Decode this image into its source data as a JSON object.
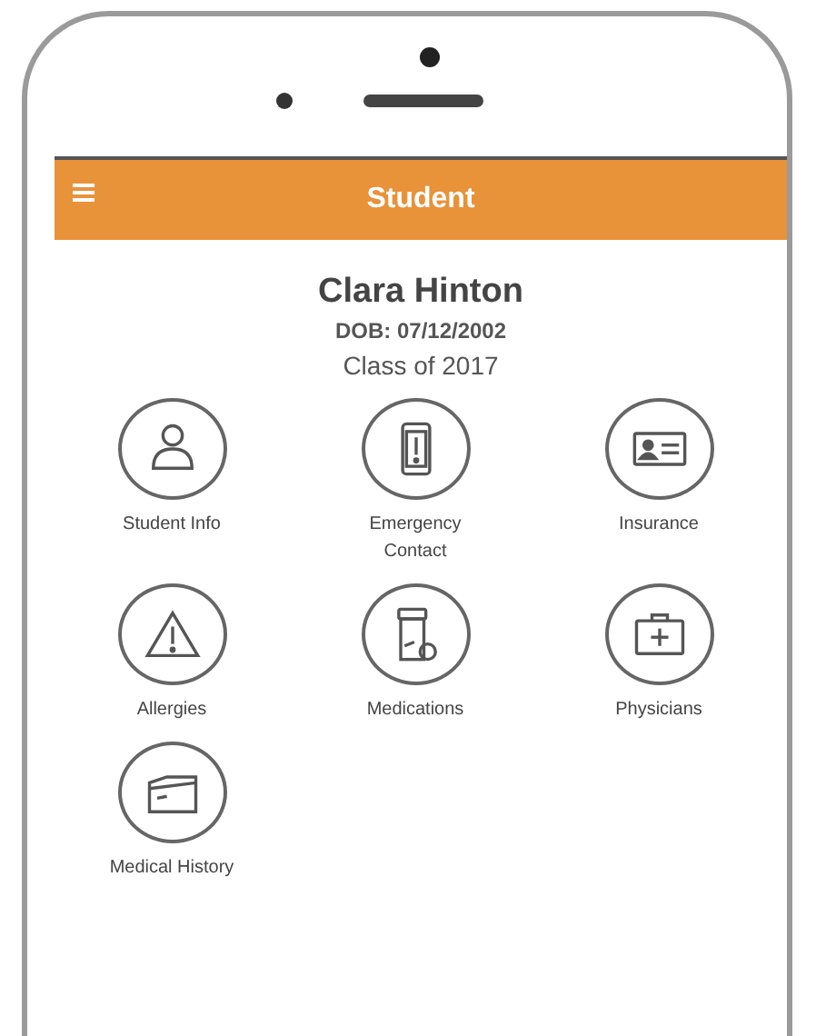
{
  "app_bar": {
    "title": "Student"
  },
  "student": {
    "name": "Clara Hinton",
    "dob": "DOB: 07/12/2002",
    "class": "Class of 2017"
  },
  "tiles": [
    {
      "label": "Student Info"
    },
    {
      "label": "Emergency Contact"
    },
    {
      "label": "Insurance"
    },
    {
      "label": "Allergies"
    },
    {
      "label": "Medications"
    },
    {
      "label": "Physicians"
    },
    {
      "label": "Medical History"
    }
  ]
}
